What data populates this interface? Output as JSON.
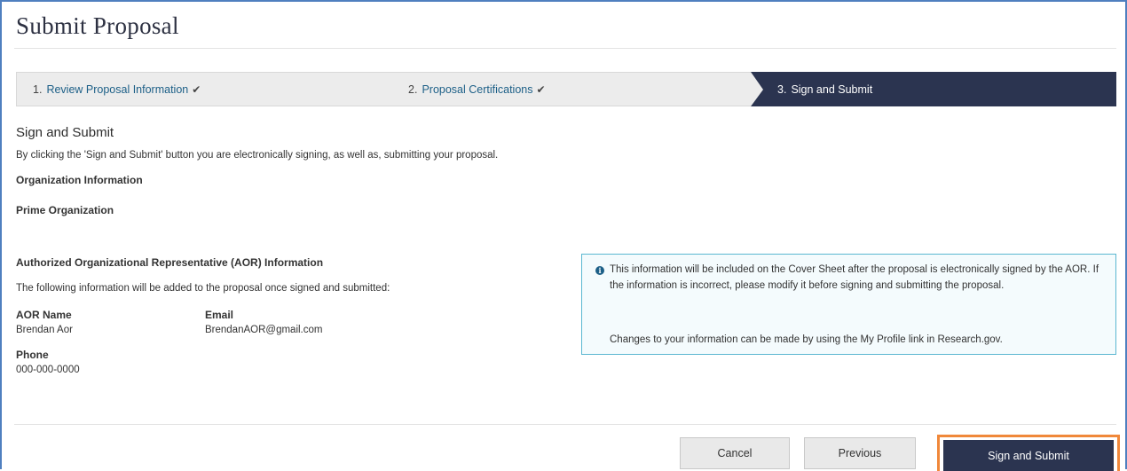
{
  "page": {
    "title": "Submit Proposal"
  },
  "stepper": {
    "steps": [
      {
        "number": "1.",
        "label": "Review Proposal Information",
        "status": "complete"
      },
      {
        "number": "2.",
        "label": "Proposal Certifications",
        "status": "complete"
      },
      {
        "number": "3.",
        "label": "Sign and Submit",
        "status": "current"
      }
    ]
  },
  "sign_section": {
    "heading": "Sign and Submit",
    "description": "By clicking the 'Sign and Submit' button you are electronically signing, as well as, submitting your proposal.",
    "org_heading": "Organization Information",
    "prime_heading": "Prime Organization"
  },
  "aor": {
    "heading": "Authorized Organizational Representative (AOR) Information",
    "description": "The following information will be added to the proposal once signed and submitted:",
    "name_label": "AOR Name",
    "name_value": "Brendan Aor",
    "email_label": "Email",
    "email_value": "BrendanAOR@gmail.com",
    "phone_label": "Phone",
    "phone_value": "000-000-0000"
  },
  "info_box": {
    "icon": "info-icon",
    "text1": "This information will be included on the Cover Sheet after the proposal is electronically signed by the AOR. If the information is incorrect, please modify it before signing and submitting the proposal.",
    "text2": "Changes to your information can be made by using the My Profile link in Research.gov."
  },
  "buttons": {
    "cancel": "Cancel",
    "previous": "Previous",
    "sign_submit": "Sign and Submit"
  },
  "colors": {
    "accent_dark": "#2b3450",
    "link": "#1c5f87",
    "highlight": "#f0883a",
    "info_border": "#5bb7d1"
  }
}
